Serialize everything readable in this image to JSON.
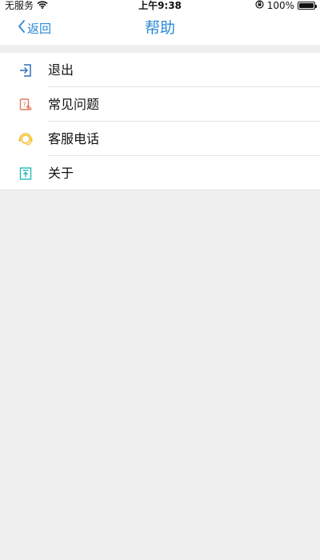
{
  "status_bar": {
    "carrier": "无服务",
    "time": "上午9:38",
    "battery": "100%",
    "wifi_icon": "wifi-icon",
    "lock_icon": "orientation-lock-icon",
    "battery_level": 1.0
  },
  "nav": {
    "back_label": "返回",
    "title": "帮助"
  },
  "menu": {
    "items": [
      {
        "label": "退出",
        "icon": "logout-icon",
        "color": "#2b6fbf"
      },
      {
        "label": "常见问题",
        "icon": "faq-icon",
        "color": "#e07a5f"
      },
      {
        "label": "客服电话",
        "icon": "headset-icon",
        "color": "#f2c230"
      },
      {
        "label": "关于",
        "icon": "about-icon",
        "color": "#27b9b5"
      }
    ]
  },
  "colors": {
    "accent": "#2b8ad8",
    "background": "#efefef",
    "divider": "#e3e3e3"
  }
}
